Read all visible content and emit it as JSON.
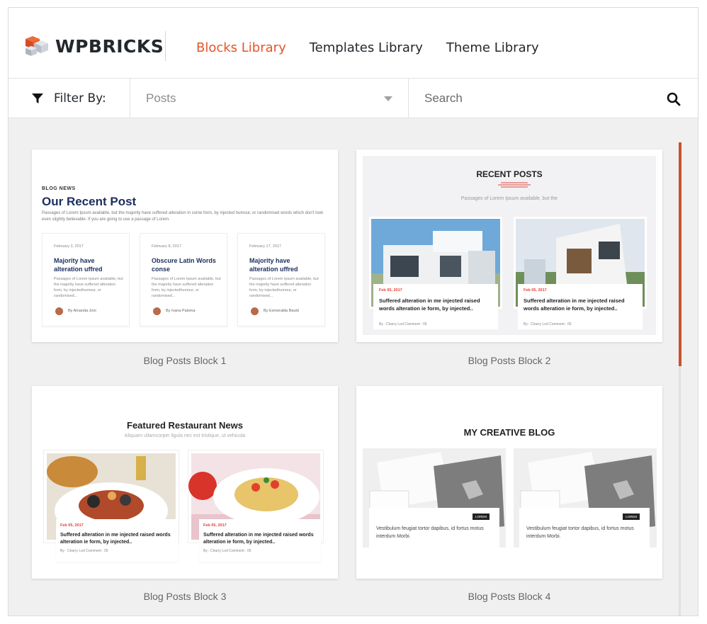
{
  "app": {
    "brand": "WPBRICKS"
  },
  "nav": [
    {
      "label": "Blocks Library",
      "active": true
    },
    {
      "label": "Templates Library",
      "active": false
    },
    {
      "label": "Theme Library",
      "active": false
    }
  ],
  "filter": {
    "label": "Filter By:",
    "selected": "Posts"
  },
  "search": {
    "placeholder": "Search"
  },
  "colors": {
    "accent": "#e2552b",
    "scroll": "#c8532d",
    "title_navy": "#1c2d5e"
  },
  "blocks": [
    {
      "caption": "Blog Posts Block 1",
      "preview": {
        "kicker": "BLOG NEWS",
        "title": "Our Recent Post",
        "desc": "Passages of Lorem Ipsum available, but the majority have suffered alteration in some form, by injected humour, or randomised words which don't look even slightly believable. If you are going to use a passage of Lorem.",
        "posts": [
          {
            "date": "February 3, 2017",
            "title": "Majority have alteration uffred",
            "excerpt": "Passages of Lorem Ipsum available, but the majority have suffered alteration form, by injectedhumour, or randomised...",
            "author": "By Amanda Joni"
          },
          {
            "date": "February 8, 2017",
            "title": "Obscure Latin Words conse",
            "excerpt": "Passages of Lorem Ipsum available, but the majority have suffered alteration form, by injectedhumour, or randomised...",
            "author": "By Ivana Paloma"
          },
          {
            "date": "February 17, 2017",
            "title": "Majority have alteration uffred",
            "excerpt": "Passages of Lorem Ipsum available, but the majority have suffered alteration form, by injectedhumour, or randomised...",
            "author": "By Esmeralda Bauld"
          }
        ]
      }
    },
    {
      "caption": "Blog Posts Block 2",
      "preview": {
        "title": "RECENT POSTS",
        "sub": "Passages of Lorem Ipsum available, but the",
        "posts": [
          {
            "date": "Feb 05, 2017",
            "title": "Suffered alteration in me injected raised words alteration ie form, by injected..",
            "meta": "By : Charry Lod Comment : 05"
          },
          {
            "date": "Feb 05, 2017",
            "title": "Suffered alteration in me injected raised words alteration ie form, by injected..",
            "meta": "By : Charry Lod Comment : 05"
          }
        ]
      }
    },
    {
      "caption": "Blog Posts Block 3",
      "preview": {
        "title": "Featured Restaurant News",
        "sub": "Aliquam ullamcorper ligula nec est tristique, ut vehicula",
        "posts": [
          {
            "date": "Feb 05, 2017",
            "title": "Suffered alteration in me injected raised words alteration ie form, by injected..",
            "meta": "By : Charry Lod Comment : 05"
          },
          {
            "date": "Feb 05, 2017",
            "title": "Suffered alteration in me injected raised words alteration ie form, by injected..",
            "meta": "By : Charry Lod Comment : 05"
          }
        ]
      }
    },
    {
      "caption": "Blog Posts Block 4",
      "preview": {
        "title": "MY CREATIVE BLOG",
        "posts": [
          {
            "tag": "LOREM",
            "text": "Vestibulum feugiat tortor dapibus, id fortus motus interdum Morbi."
          },
          {
            "tag": "LOREM",
            "text": "Vestibulum feugiat tortor dapibus, id fortus motus interdum Morbi."
          }
        ]
      }
    }
  ]
}
